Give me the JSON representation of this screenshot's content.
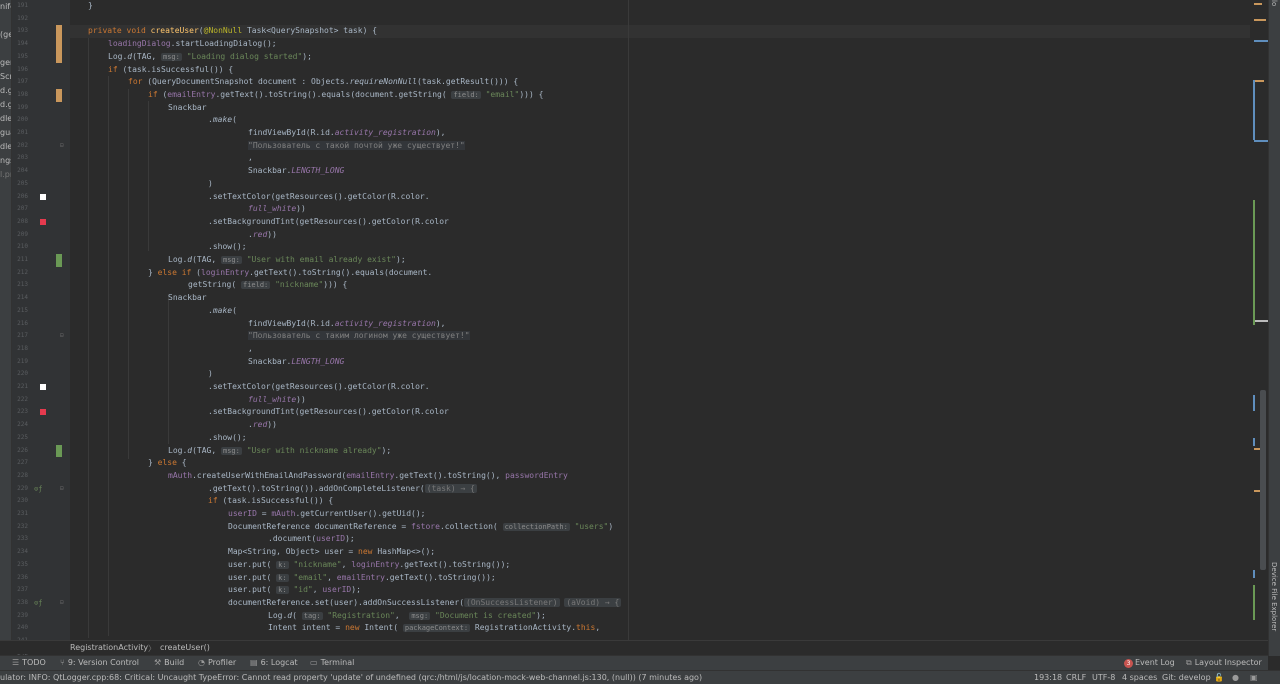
{
  "project_panel": {
    "items": [
      "nife",
      "(ge",
      "ger",
      "Scri",
      "d.g",
      "d.g",
      "dle-",
      "guar",
      "dle.p",
      "ngs",
      "l.pr"
    ]
  },
  "gutter": {
    "line_numbers": [
      "191",
      "192",
      "193",
      "194",
      "195",
      "196",
      "197",
      "198",
      "199",
      "200",
      "201",
      "202",
      "203",
      "204",
      "205",
      "206",
      "207",
      "208",
      "209",
      "210",
      "211",
      "212",
      "213",
      "214",
      "215",
      "216",
      "217",
      "218",
      "219",
      "220",
      "221",
      "222",
      "223",
      "224",
      "225",
      "226",
      "227",
      "228",
      "229",
      "230",
      "231",
      "232",
      "233",
      "234",
      "235",
      "236",
      "237",
      "238",
      "239",
      "240",
      "241",
      "242",
      "243",
      "244",
      "245",
      "246"
    ],
    "color_swatches": [
      "#ffffff",
      "#e53a4e"
    ]
  },
  "code": {
    "hints": {
      "msg": "msg:",
      "field": "field:",
      "collection_path": "collectionPath:",
      "k": "k:",
      "tag": "tag:",
      "package_context": "packageContext:",
      "task_lambda": "(task) → {",
      "on_success_listener": "(OnSuccessListener)",
      "void_lambda": "(aVoid) → {"
    },
    "strings": {
      "loading_dialog_started": "\"Loading dialog started\"",
      "email": "\"email\"",
      "email_exists_ru": "\"Пользователь с такой почтой уже существует!\"",
      "user_email_exists": "\"User with email already exist\"",
      "nickname": "\"nickname\"",
      "login_exists_ru": "\"Пользователь с таким логином уже существует!\"",
      "user_nickname_exists": "\"User with nickname already\"",
      "users": "\"users\"",
      "id": "\"id\"",
      "registration": "\"Registration\"",
      "document_created": "\"Document is created\""
    }
  },
  "breadcrumb": {
    "class_name": "RegistrationActivity",
    "separator": "〉",
    "method_name": "createUser()"
  },
  "tool_windows": {
    "todo": "TODO",
    "version_control": "9: Version Control",
    "build": "Build",
    "profiler": "Profiler",
    "logcat": "6: Logcat",
    "terminal": "Terminal",
    "event_log_count": "3",
    "event_log": "Event Log",
    "layout_inspector": "Layout Inspector"
  },
  "right_toolbar": {
    "top_label": "lo",
    "device_file_explorer": "Device File Explorer"
  },
  "status_bar": {
    "message": "ulator: INFO: QtLogger.cpp:68: Critical: Uncaught TypeError: Cannot read property 'update' of undefined (qrc:/html/js/location-mock-web-channel.js:130, (null)) (7 minutes ago)",
    "position": "193:18",
    "line_separator": "CRLF",
    "encoding": "UTF-8",
    "indent": "4 spaces",
    "vcs": "Git: develop"
  },
  "colors": {
    "editor_bg": "#2b2b2b",
    "gutter_bg": "#313335",
    "keyword": "#cc7832",
    "method": "#ffc66d",
    "string": "#6a8759",
    "field": "#9876aa",
    "added_marker": "#6a9955",
    "modified_marker": "#c9975c",
    "error_badge": "#c75450"
  }
}
